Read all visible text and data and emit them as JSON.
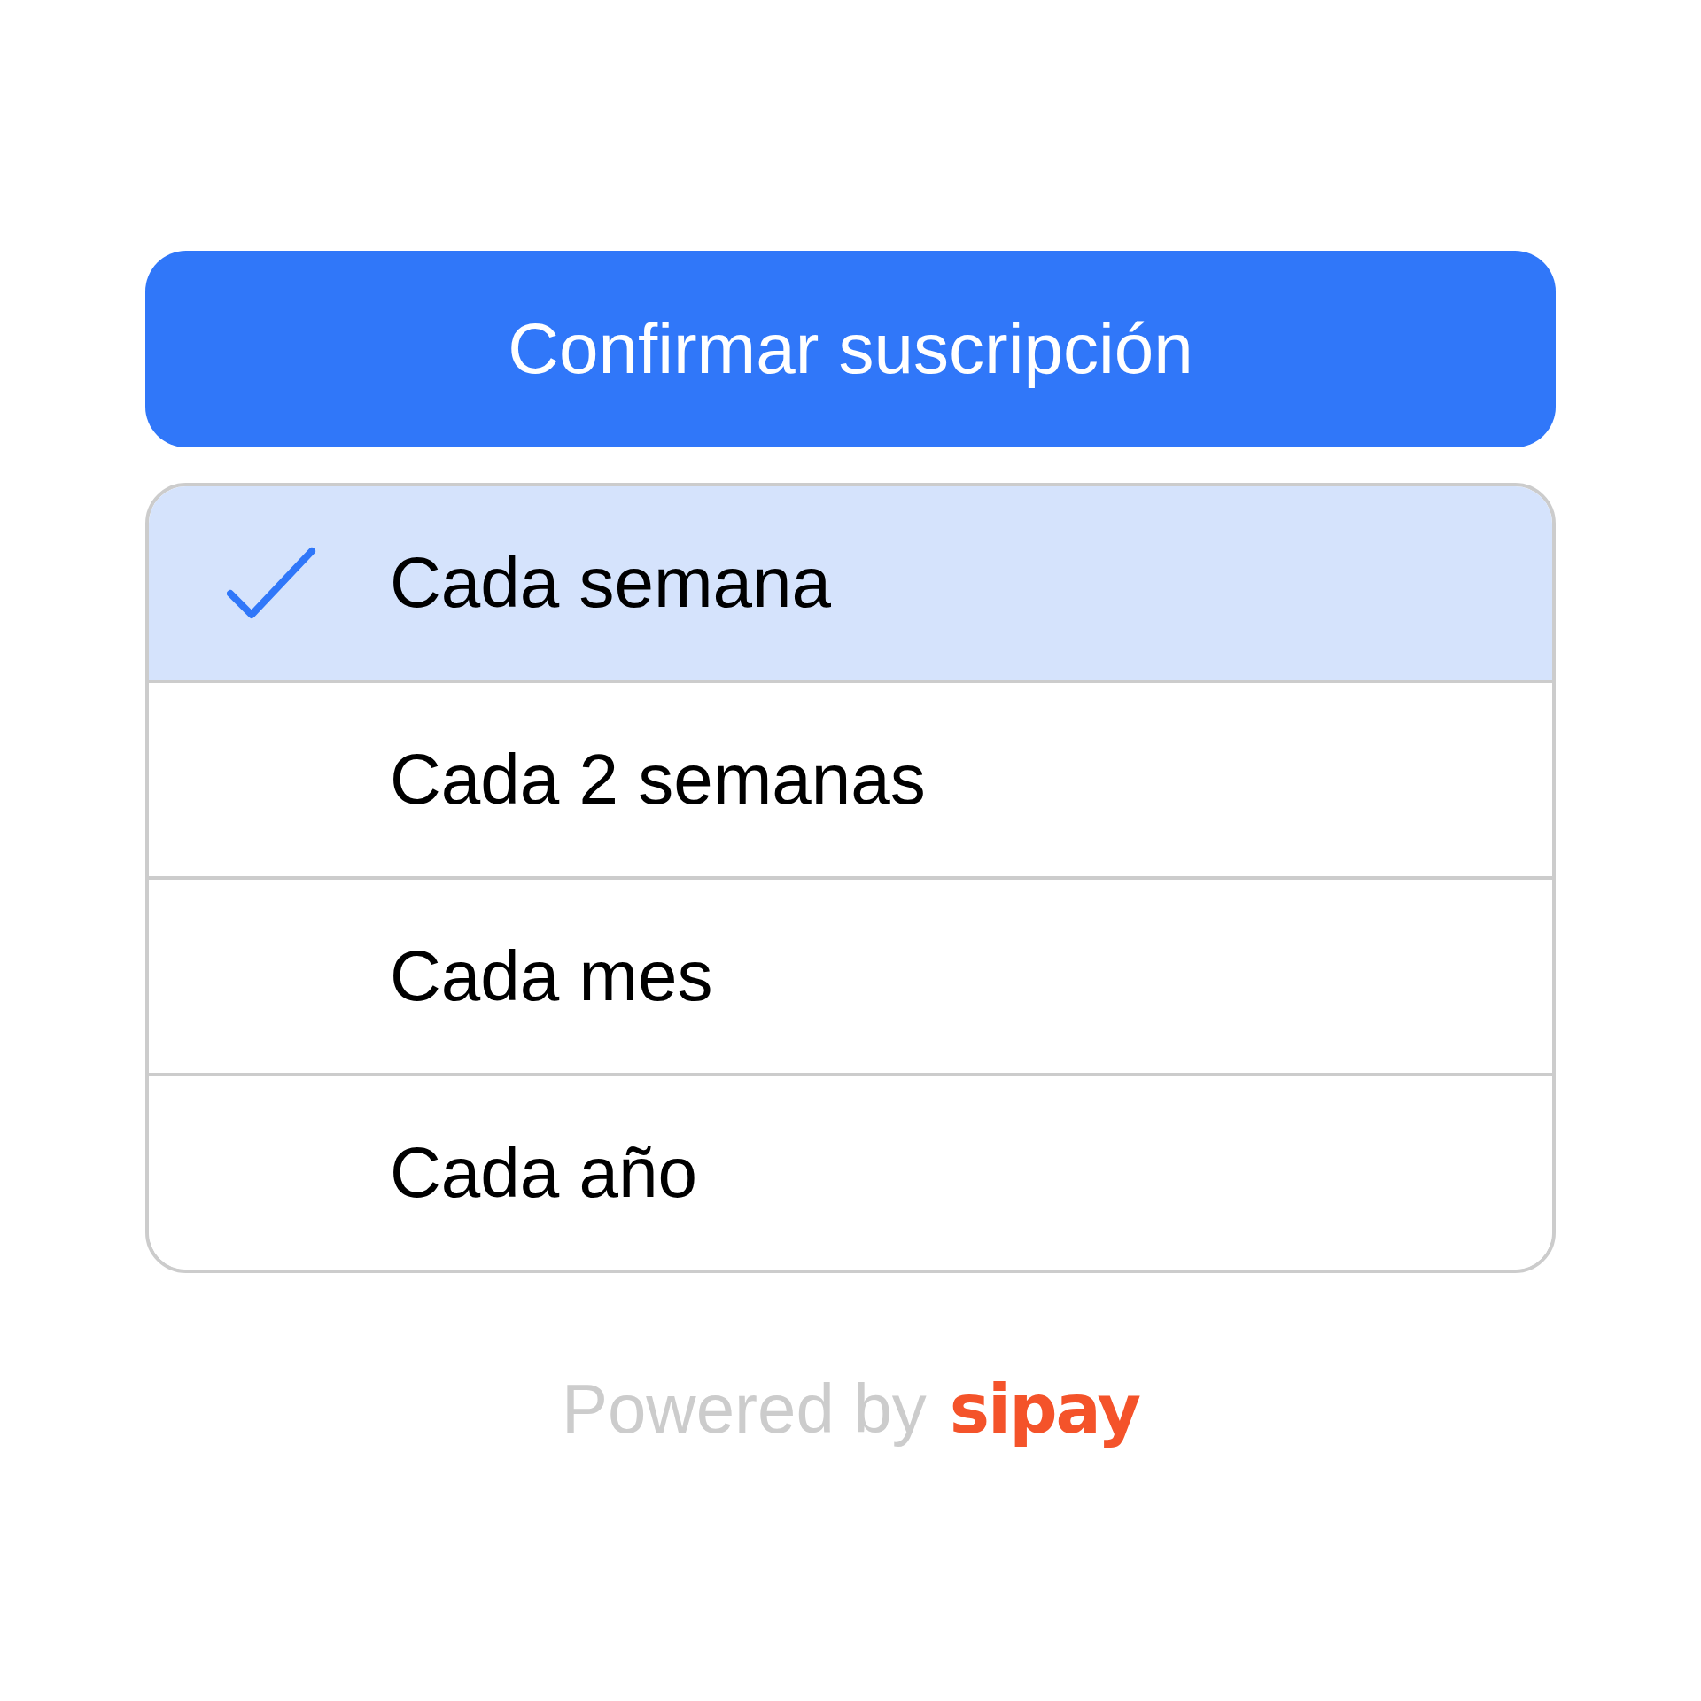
{
  "confirm_button": {
    "label": "Confirmar suscripción"
  },
  "options": [
    {
      "label": "Cada semana",
      "selected": true
    },
    {
      "label": "Cada 2 semanas",
      "selected": false
    },
    {
      "label": "Cada mes",
      "selected": false
    },
    {
      "label": "Cada año",
      "selected": false
    }
  ],
  "footer": {
    "text": "Powered by",
    "brand": "sipay"
  }
}
